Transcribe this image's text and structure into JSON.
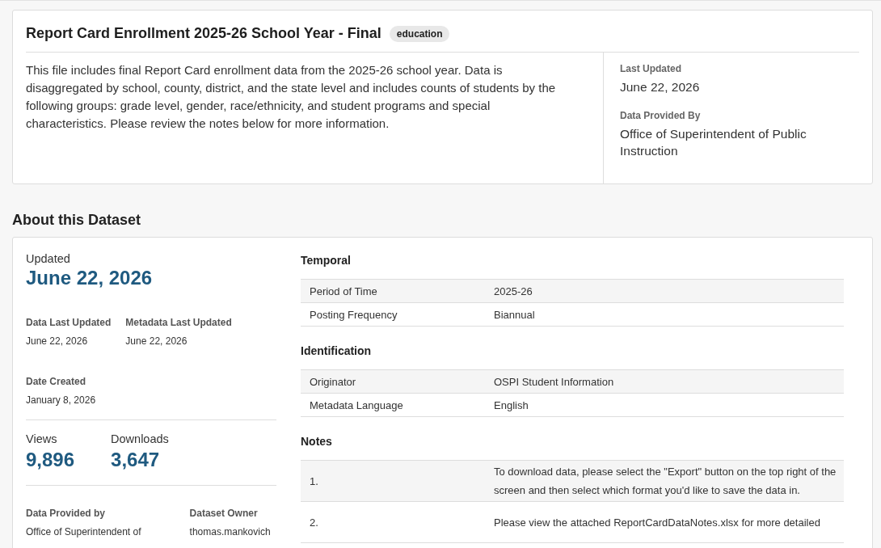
{
  "header": {
    "title": "Report Card Enrollment 2025-26 School Year - Final",
    "tag": "education",
    "description": "This file includes final Report Card enrollment data from the 2025-26 school year. Data is disaggregated by school, county, district, and the state level and includes counts of students by the following groups: grade level, gender, race/ethnicity, and student programs and special characteristics. Please review the notes below for more information.",
    "facts": [
      {
        "label": "Last Updated",
        "value": "June 22, 2026"
      },
      {
        "label": "Data Provided By",
        "value": "Office of Superintendent of Public Instruction"
      }
    ]
  },
  "about": {
    "heading": "About this Dataset",
    "updated": {
      "label": "Updated",
      "value": "June 22, 2026"
    },
    "dates": [
      {
        "label": "Data Last Updated",
        "value": "June 22, 2026"
      },
      {
        "label": "Metadata Last Updated",
        "value": "June 22, 2026"
      }
    ],
    "created": {
      "label": "Date Created",
      "value": "January 8, 2026"
    },
    "stats": [
      {
        "label": "Views",
        "value": "9,896"
      },
      {
        "label": "Downloads",
        "value": "3,647"
      }
    ],
    "owners": [
      {
        "label": "Data Provided by",
        "value": "Office of Superintendent of"
      },
      {
        "label": "Dataset Owner",
        "value": "thomas.mankovich"
      }
    ],
    "sections": [
      {
        "title": "Temporal",
        "kind": "pairs",
        "rows": [
          {
            "key": "Period of Time",
            "value": "2025-26"
          },
          {
            "key": "Posting Frequency",
            "value": "Biannual"
          }
        ]
      },
      {
        "title": "Identification",
        "kind": "pairs",
        "rows": [
          {
            "key": "Originator",
            "value": "OSPI Student Information"
          },
          {
            "key": "Metadata Language",
            "value": "English"
          }
        ]
      },
      {
        "title": "Notes",
        "kind": "notes",
        "rows": [
          {
            "key": "1.",
            "value": "To download data, please select the \"Export\" button on the top right of the screen and then select which format you'd like to save the data in."
          },
          {
            "key": "2.",
            "value": "Please view the attached ReportCardDataNotes.xlsx for more detailed"
          }
        ]
      }
    ]
  }
}
